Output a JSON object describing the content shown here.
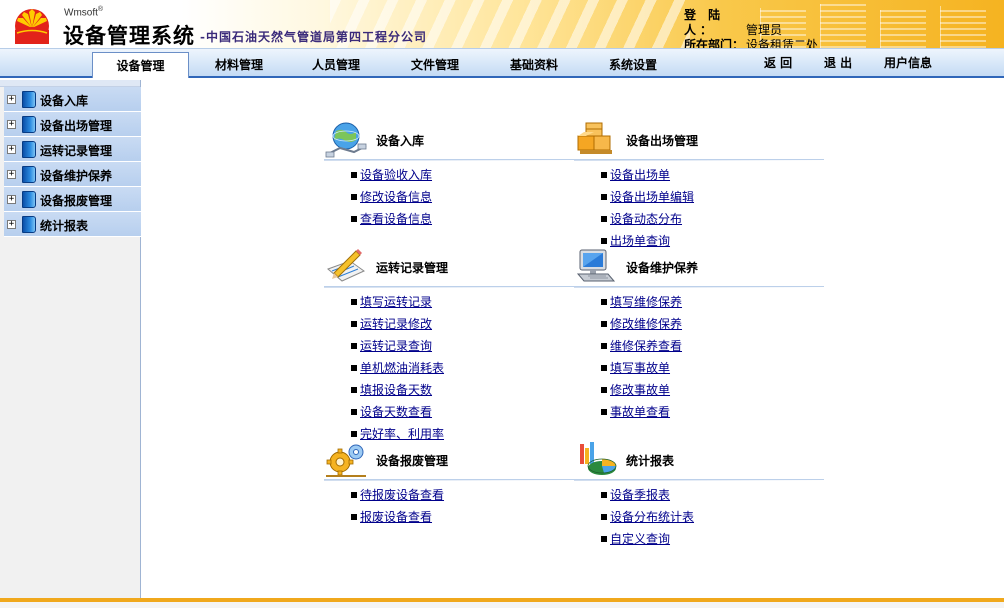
{
  "header": {
    "brand": "Wmsoft",
    "registered": "®",
    "title": "设备管理系统",
    "subtitle": "-中国石油天然气管道局第四工程分公司",
    "user_label": "登 陆 人：",
    "user_value": "管理员",
    "dept_label": "所在部门：",
    "dept_value": "设备租赁二处"
  },
  "nav": {
    "tabs": [
      "设备管理",
      "材料管理",
      "人员管理",
      "文件管理",
      "基础资料",
      "系统设置"
    ],
    "active_index": 0,
    "back_label": "返 回",
    "logout_label": "退 出",
    "user_info_label": "用户信息"
  },
  "sidebar": {
    "items": [
      {
        "label": "设备入库"
      },
      {
        "label": "设备出场管理"
      },
      {
        "label": "运转记录管理"
      },
      {
        "label": "设备维护保养"
      },
      {
        "label": "设备报废管理"
      },
      {
        "label": "统计报表"
      }
    ]
  },
  "sections": {
    "device_in": {
      "title": "设备入库",
      "icon": "globe-network-icon",
      "links": [
        "设备验收入库",
        "修改设备信息",
        "查看设备信息"
      ]
    },
    "device_out": {
      "title": "设备出场管理",
      "icon": "boxes-icon",
      "links": [
        "设备出场单",
        "设备出场单编辑",
        "设备动态分布",
        "出场单查询"
      ]
    },
    "operation": {
      "title": "运转记录管理",
      "icon": "pencil-clipboard-icon",
      "links": [
        "填写运转记录",
        "运转记录修改",
        "运转记录查询",
        "单机燃油消耗表",
        "填报设备天数",
        "设备天数查看",
        "完好率、利用率"
      ]
    },
    "maintenance": {
      "title": "设备维护保养",
      "icon": "computer-monitor-icon",
      "links": [
        "填写维修保养",
        "修改维修保养",
        "维修保养查看",
        "填写事故单",
        "修改事故单",
        "事故单查看"
      ]
    },
    "scrap": {
      "title": "设备报废管理",
      "icon": "gears-icon",
      "links": [
        "待报废设备查看",
        "报废设备查看"
      ]
    },
    "reports": {
      "title": "统计报表",
      "icon": "pie-chart-icon",
      "links": [
        "设备季报表",
        "设备分布统计表",
        "自定义查询"
      ]
    }
  },
  "colors": {
    "nav_border": "#2f66b9",
    "link": "#00008b",
    "footer_accent": "#f0a81c",
    "brand_red": "#e2231a",
    "brand_yellow": "#ffcc00"
  }
}
